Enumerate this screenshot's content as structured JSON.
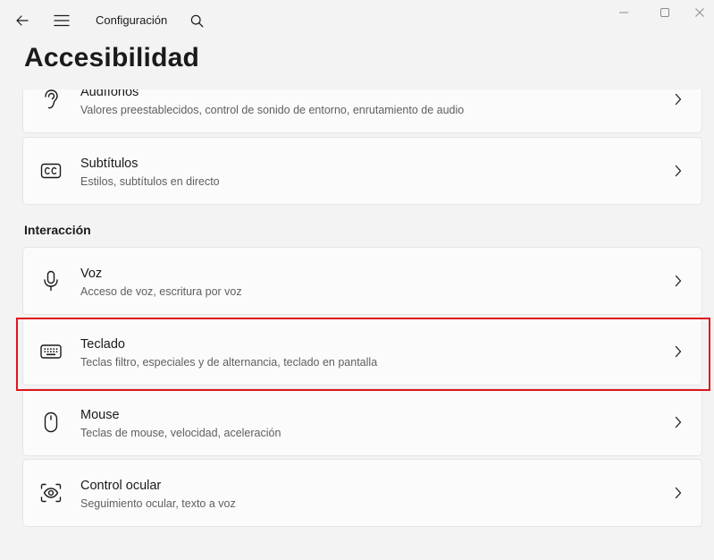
{
  "window": {
    "title": "Configuración",
    "controls": [
      "minimize-icon",
      "maximize-icon",
      "close-icon"
    ]
  },
  "header": {
    "back_icon": "back-arrow-icon",
    "menu_icon": "hamburger-menu-icon",
    "search_icon": "search-icon"
  },
  "page": {
    "title": "Accesibilidad"
  },
  "cards_top": [
    {
      "icon": "hearing-icon",
      "label": "Audífonos",
      "desc": "Valores preestablecidos, control de sonido de entorno, enrutamiento de audio"
    },
    {
      "icon": "captions-icon",
      "label": "Subtítulos",
      "desc": "Estilos, subtítulos en directo"
    }
  ],
  "section": {
    "title": "Interacción"
  },
  "cards_interaction": [
    {
      "icon": "microphone-icon",
      "label": "Voz",
      "desc": "Acceso de voz, escritura por voz"
    },
    {
      "icon": "keyboard-icon",
      "label": "Teclado",
      "desc": "Teclas filtro, especiales y de alternancia, teclado en pantalla"
    },
    {
      "icon": "mouse-icon",
      "label": "Mouse",
      "desc": "Teclas de mouse, velocidad, aceleración"
    },
    {
      "icon": "eye-control-icon",
      "label": "Control ocular",
      "desc": "Seguimiento ocular, texto a voz"
    }
  ],
  "colors": {
    "highlight": "#e0141e",
    "background": "#f3f3f3",
    "card": "#fbfbfb"
  }
}
